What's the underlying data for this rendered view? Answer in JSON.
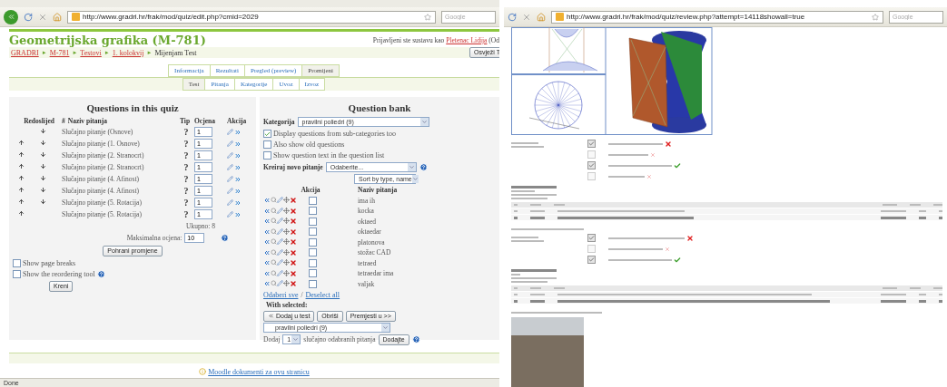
{
  "left_window": {
    "address": "http://www.gradri.hr/frak/mod/quiz/edit.php?cmid=2029",
    "search_placeholder": "Google",
    "course_title": "Geometrijska grafika (M-781)",
    "login": {
      "prefix": "Prijavljeni ste sustavu kao",
      "user": "Pletenac Lidija",
      "suffix": "(Od"
    },
    "breadcrumb": [
      {
        "kind": "link",
        "label": "GRADRI"
      },
      {
        "kind": "separator",
        "label": "►"
      },
      {
        "kind": "link",
        "label": "M-781"
      },
      {
        "kind": "separator",
        "label": "►"
      },
      {
        "kind": "link",
        "label": "Testovi"
      },
      {
        "kind": "separator",
        "label": "►"
      },
      {
        "kind": "link",
        "label": "1. kolokvij"
      },
      {
        "kind": "separator",
        "label": "►"
      },
      {
        "kind": "current",
        "label": "Mijenjam Test"
      }
    ],
    "update_button": "Osvježi T",
    "tabs": [
      {
        "label": "Informacija",
        "selected": false
      },
      {
        "label": "Rezultati",
        "selected": false
      },
      {
        "label": "Pregled (preview)",
        "selected": false
      },
      {
        "label": "Promijeni",
        "selected": true
      }
    ],
    "subtabs": [
      {
        "label": "Test",
        "selected": true
      },
      {
        "label": "Pitanja",
        "selected": false
      },
      {
        "label": "Kategorije",
        "selected": false
      },
      {
        "label": "Uvoz",
        "selected": false
      },
      {
        "label": "Izvoz",
        "selected": false
      }
    ],
    "quiz": {
      "title": "Questions in this quiz",
      "headers": {
        "order": "Redoslijed",
        "number": "#",
        "name": "Naziv pitanja",
        "type": "Tip",
        "grade": "Ocjena",
        "action": "Akcija"
      },
      "rows": [
        {
          "name": "Slučajno pitanje (Osnove)",
          "up": false,
          "down": true,
          "type": "?",
          "grade": "1"
        },
        {
          "name": "Slučajno pitanje (1. Osnove)",
          "up": true,
          "down": true,
          "type": "?",
          "grade": "1"
        },
        {
          "name": "Slučajno pitanje (2. Stranocrt)",
          "up": true,
          "down": true,
          "type": "?",
          "grade": "1"
        },
        {
          "name": "Slučajno pitanje (2. Stranocrt)",
          "up": true,
          "down": true,
          "type": "?",
          "grade": "1"
        },
        {
          "name": "Slučajno pitanje (4. Afinost)",
          "up": true,
          "down": true,
          "type": "?",
          "grade": "1"
        },
        {
          "name": "Slučajno pitanje (4. Afinost)",
          "up": true,
          "down": true,
          "type": "?",
          "grade": "1"
        },
        {
          "name": "Slučajno pitanje (5. Rotacija)",
          "up": true,
          "down": true,
          "type": "?",
          "grade": "1"
        },
        {
          "name": "Slučajno pitanje (5. Rotacija)",
          "up": true,
          "down": false,
          "type": "?",
          "grade": "1"
        }
      ],
      "total": "Ukupno: 8",
      "max_label": "Maksimalna ocjena:",
      "max_value": "10",
      "save_button": "Pohrani promjene",
      "options": [
        {
          "label": "Show page breaks",
          "checked": false,
          "help": false
        },
        {
          "label": "Show the reordering tool",
          "checked": false,
          "help": true
        }
      ],
      "go_button": "Kreni"
    },
    "bank": {
      "title": "Question bank",
      "category_label": "Kategorija",
      "category": "pravilni poliedri (9)",
      "options": [
        {
          "label": "Display questions from sub-categories too",
          "checked": true
        },
        {
          "label": "Also show old questions",
          "checked": false
        },
        {
          "label": "Show question text in the question list",
          "checked": false
        }
      ],
      "create_label": "Kreiraj novo pitanje",
      "create_value": "Odaberite...",
      "sort": "Sort by type, name",
      "headers": {
        "action": "Akcija",
        "name": "Naziv pitanja"
      },
      "rows": [
        {
          "name": "ima ih",
          "checked": false
        },
        {
          "name": "kocka",
          "checked": false
        },
        {
          "name": "oktaed",
          "checked": false
        },
        {
          "name": "oktaedar",
          "checked": false
        },
        {
          "name": "platonova",
          "checked": false
        },
        {
          "name": "stožac CAD",
          "checked": false
        },
        {
          "name": "tetraed",
          "checked": false
        },
        {
          "name": "tetraedar ima",
          "checked": false
        },
        {
          "name": "valjak",
          "checked": false
        }
      ],
      "select_all": "Odaberi sve",
      "slash": "/",
      "deselect_all": "Deselect all",
      "with_selected": "With selected:",
      "add_button": "Dodaj u test",
      "delete_button": "Obriši",
      "move_button": "Premjesti u >>",
      "move_target": "pravilni poliedri (9)",
      "add_label": "Dodaj",
      "add_count": "1",
      "random_label": "slučajno odabranih pitanja",
      "random_button": "Dodajte"
    },
    "footer_link": "Moodle dokumenti za ovu stranicu",
    "status": "Done"
  },
  "right_window": {
    "address": "http://www.gradri.hr/frak/mod/quiz/review.php?attempt=14118showall=true",
    "search_placeholder": "Google",
    "answer_groups": [
      {
        "options": [
          {
            "checked": true,
            "kind": "incorrect"
          },
          {
            "checked": false,
            "kind": "faint"
          },
          {
            "checked": true,
            "kind": "correct"
          },
          {
            "checked": false,
            "kind": "faint"
          }
        ]
      },
      {
        "options": [
          {
            "checked": true,
            "kind": "incorrect"
          },
          {
            "checked": false,
            "kind": "faint"
          },
          {
            "checked": true,
            "kind": "correct"
          }
        ]
      }
    ]
  }
}
